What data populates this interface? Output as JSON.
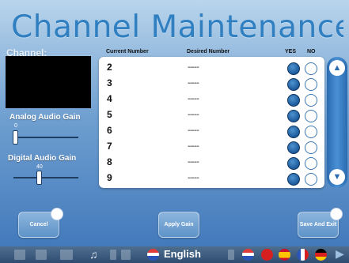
{
  "header": {
    "title": "Channel Maintenance"
  },
  "left_panel": {
    "channel_label": "Channel:",
    "analog_label": "Analog Audio Gain",
    "analog_value": "0",
    "analog_level": 0,
    "digital_label": "Digital Audio Gain",
    "digital_value": "40",
    "digital_level": 0.4
  },
  "table": {
    "columns": [
      "Current Number",
      "Desired Number",
      "YES",
      "NO"
    ],
    "rows": [
      {
        "current": "2",
        "desired": "-----"
      },
      {
        "current": "3",
        "desired": "-----"
      },
      {
        "current": "4",
        "desired": "-----"
      },
      {
        "current": "5",
        "desired": "-----"
      },
      {
        "current": "6",
        "desired": "-----"
      },
      {
        "current": "7",
        "desired": "-----"
      },
      {
        "current": "8",
        "desired": "-----"
      },
      {
        "current": "9",
        "desired": "-----"
      }
    ]
  },
  "buttons": {
    "cancel": "Cancel",
    "apply_gain": "Apply Gain",
    "save_exit": "Save And Exit"
  },
  "taskbar": {
    "language": "English"
  },
  "colors": {
    "accent": "#2f7fc1",
    "radio_selected": "#1c5a9b",
    "background_top": "#b9d5ec",
    "background_bottom": "#3d75b9"
  }
}
